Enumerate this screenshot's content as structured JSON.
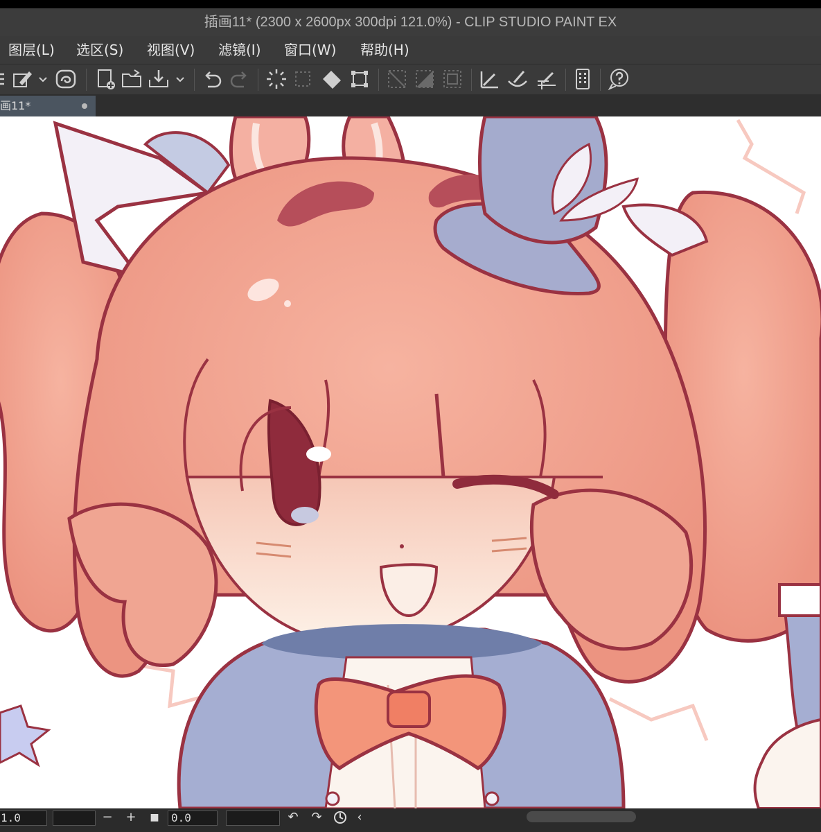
{
  "window": {
    "title": "插画11* (2300 x 2600px 300dpi 121.0%)  - CLIP STUDIO PAINT EX"
  },
  "menu": [
    {
      "label": "图层(L)"
    },
    {
      "label": "选区(S)"
    },
    {
      "label": "视图(V)"
    },
    {
      "label": "滤镜(I)"
    },
    {
      "label": "窗口(W)"
    },
    {
      "label": "帮助(H)"
    }
  ],
  "toolbar": {
    "icons": [
      "menu-icon",
      "pen-settings-icon",
      "chevron-down-icon",
      "spiral-icon",
      "new-canvas-icon",
      "open-folder-icon",
      "export-icon",
      "chevron-down-icon",
      "undo-icon",
      "redo-icon",
      "select-all-icon",
      "deselect-icon",
      "fill-icon",
      "transform-icon",
      "invert-selection-icon",
      "selection-area-icon",
      "selection-border-icon",
      "ruler-snap-icon",
      "special-ruler-icon",
      "grid-snap-icon",
      "device-icon",
      "help-icon"
    ]
  },
  "tab": {
    "label": "画11*"
  },
  "status": {
    "zoom_value": "1.0",
    "angle_value": "0.0",
    "minus": "−",
    "plus": "+",
    "stop": "■",
    "rotate_left": "↶",
    "rotate_right": "↷",
    "arrow": "‹"
  },
  "colors": {
    "chrome_dark": "#3a3a3a",
    "tab_active": "#4b5560",
    "canvas_bg": "#ffffff",
    "hair": "#f0a592",
    "lineart": "#9a3242",
    "outfit": "#9aa3c8"
  }
}
